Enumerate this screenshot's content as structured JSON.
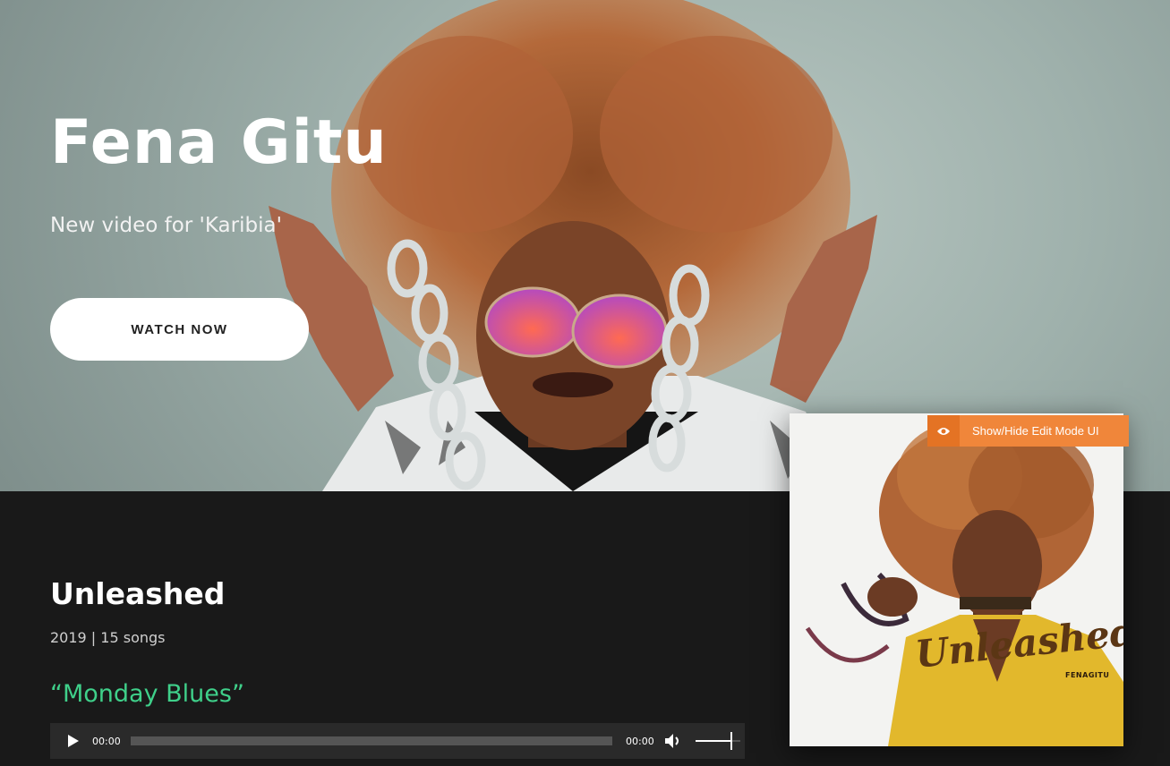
{
  "hero": {
    "title": "Fena Gitu",
    "subtitle": "New video for 'Karibia'",
    "cta_label": "WATCH NOW"
  },
  "album": {
    "title": "Unleashed",
    "meta": "2019 | 15 songs",
    "track_title": "“Monday Blues”",
    "cover_word": "Unleashed",
    "cover_artist": "FENAGITU"
  },
  "player": {
    "current_time": "00:00",
    "duration": "00:00",
    "progress": 0,
    "volume": 0.8
  },
  "edit_toggle": {
    "label": "Show/Hide Edit Mode UI",
    "icon": "eye-icon"
  },
  "colors": {
    "accent_green": "#3fd08a",
    "edit_orange": "#f0863a",
    "dark_bg": "#191919"
  }
}
